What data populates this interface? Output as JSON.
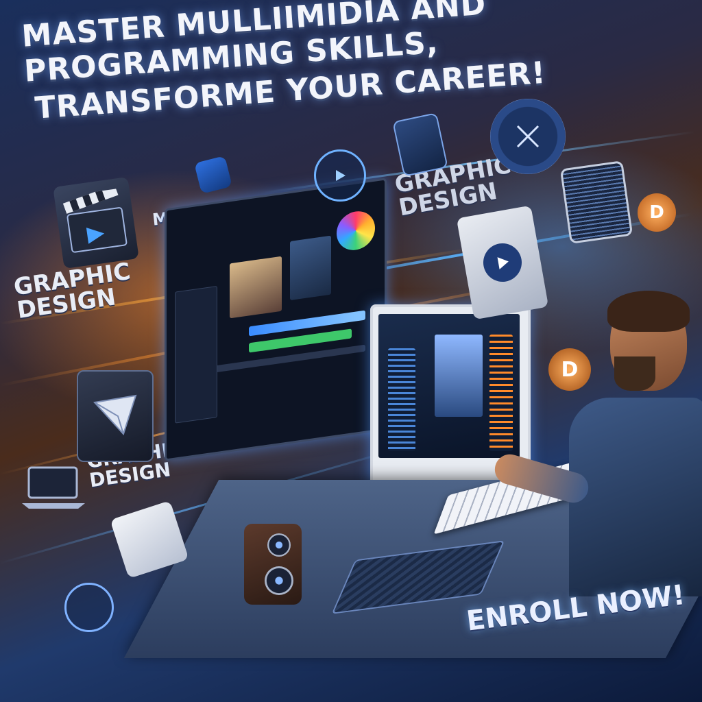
{
  "headline": {
    "line1": "MASTER MULLIIMIDIA AND PROGRAMMING SKILLS,",
    "line2": "TRANSFORME YOUR CAREER!"
  },
  "labels": {
    "multimedia": "MULTIMEDIA",
    "graphic_design_top_right": "GRAPHIC DESIGN",
    "graphic_design_left": "GRAPHIC DESIGN",
    "graphic_design_bottom_left": "GRAPHIC DESIGN"
  },
  "cta": {
    "enroll": "ENROLL NOW!"
  },
  "icons": {
    "clapperboard": "clapperboard-icon",
    "play": "play-icon",
    "envelope": "envelope-icon",
    "laptop": "laptop-icon",
    "speaker": "speaker-icon",
    "mouse": "mouse-icon",
    "keyboard": "keyboard-icon",
    "badge_letter": "D"
  },
  "colors": {
    "accent_orange": "#ff8a2a",
    "accent_blue": "#3b9bff",
    "text_light": "#eef2fa"
  }
}
